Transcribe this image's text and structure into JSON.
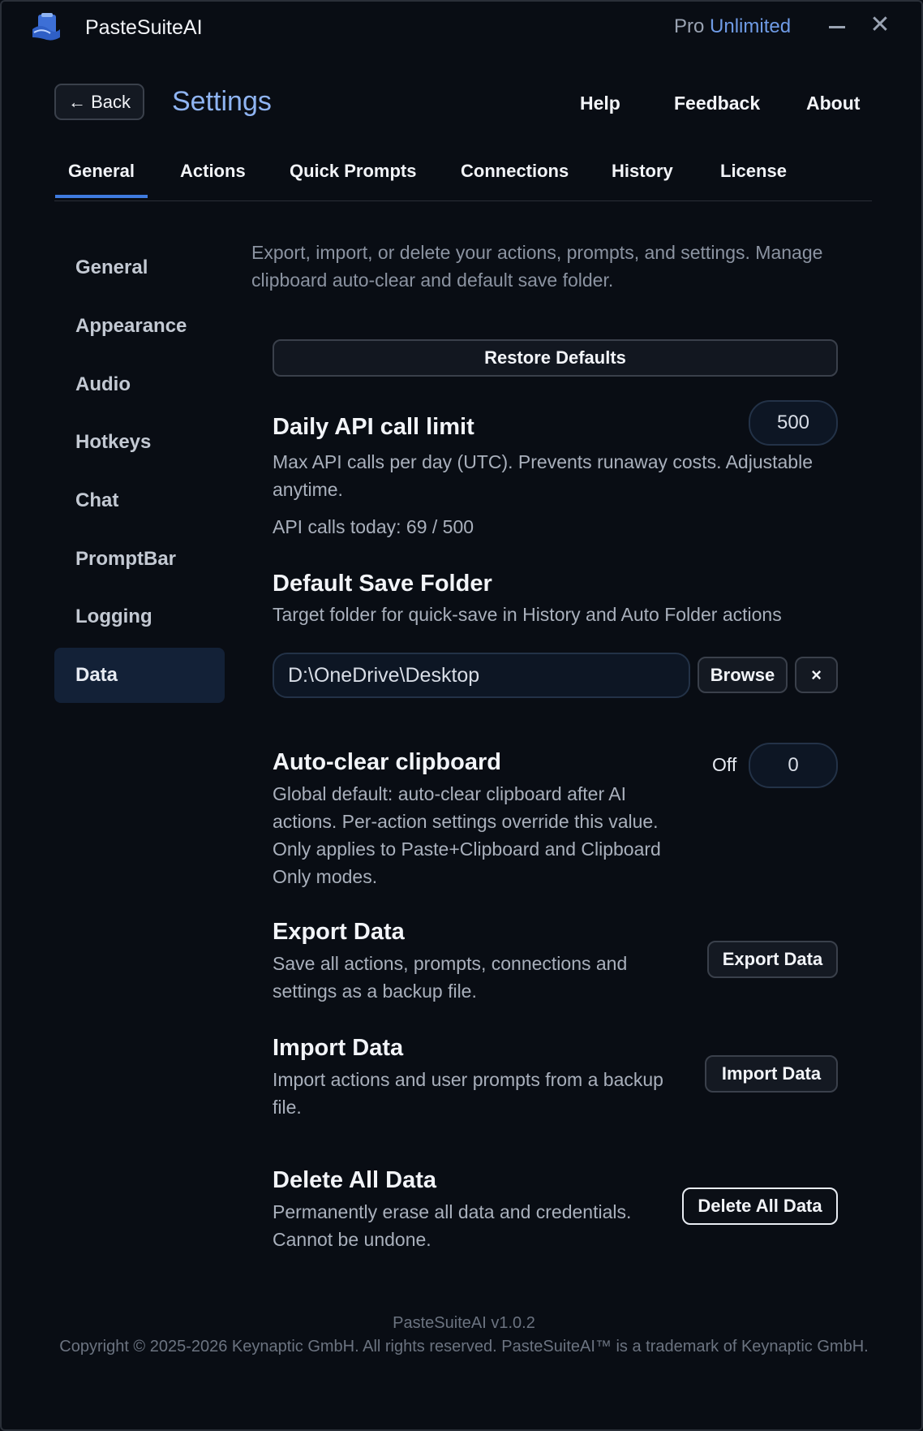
{
  "app": {
    "name": "PasteSuiteAI",
    "plan_prefix": "Pro",
    "plan_highlight": "Unlimited",
    "minimize_icon": "minimize-icon",
    "close_icon": "close-icon",
    "close_glyph": "✕"
  },
  "header": {
    "back_label": "← Back",
    "title": "Settings",
    "links": [
      "Help",
      "Feedback",
      "About"
    ]
  },
  "tabs": [
    {
      "label": "General",
      "active": true
    },
    {
      "label": "Actions"
    },
    {
      "label": "Quick Prompts"
    },
    {
      "label": "Connections"
    },
    {
      "label": "History"
    },
    {
      "label": "License"
    }
  ],
  "sidebar": {
    "items": [
      {
        "label": "General"
      },
      {
        "label": "Appearance"
      },
      {
        "label": "Audio"
      },
      {
        "label": "Hotkeys"
      },
      {
        "label": "Chat"
      },
      {
        "label": "PromptBar"
      },
      {
        "label": "Logging"
      },
      {
        "label": "Data",
        "active": true
      }
    ]
  },
  "content": {
    "intro": "Export, import, or delete your actions, prompts, and settings. Manage clipboard auto-clear and default save folder.",
    "restore_label": "Restore Defaults",
    "api_limit": {
      "title": "Daily API call limit",
      "desc": "Max API calls per day (UTC). Prevents runaway costs. Adjustable anytime.",
      "usage": "API calls today: 69 / 500",
      "value": "500"
    },
    "save_folder": {
      "title": "Default Save Folder",
      "desc": "Target folder for quick-save in History and Auto Folder actions",
      "value": "D:\\OneDrive\\Desktop",
      "browse_label": "Browse",
      "clear_label": "×"
    },
    "auto_clear": {
      "title": "Auto-clear clipboard",
      "desc": "Global default: auto-clear clipboard after AI actions. Per-action settings override this value. Only applies to Paste+Clipboard and Clipboard Only modes.",
      "state": "Off",
      "value": "0"
    },
    "export": {
      "title": "Export Data",
      "desc": "Save all actions, prompts, connections and settings as a backup file.",
      "button": "Export Data"
    },
    "import": {
      "title": "Import Data",
      "desc": "Import actions and user prompts from a backup file.",
      "button": "Import Data"
    },
    "delete": {
      "title": "Delete All Data",
      "desc": "Permanently erase all data and credentials. Cannot be undone.",
      "button": "Delete All Data"
    }
  },
  "footer": {
    "version": "PasteSuiteAI v1.0.2",
    "copyright": "Copyright © 2025-2026 Keynaptic GmbH. All rights reserved. PasteSuiteAI™ is a trademark of Keynaptic GmbH."
  },
  "colors": {
    "background": "#090d14",
    "accent": "#3f7be0",
    "title_accent": "#8fb4f2",
    "plan_accent": "#6f9be6"
  }
}
